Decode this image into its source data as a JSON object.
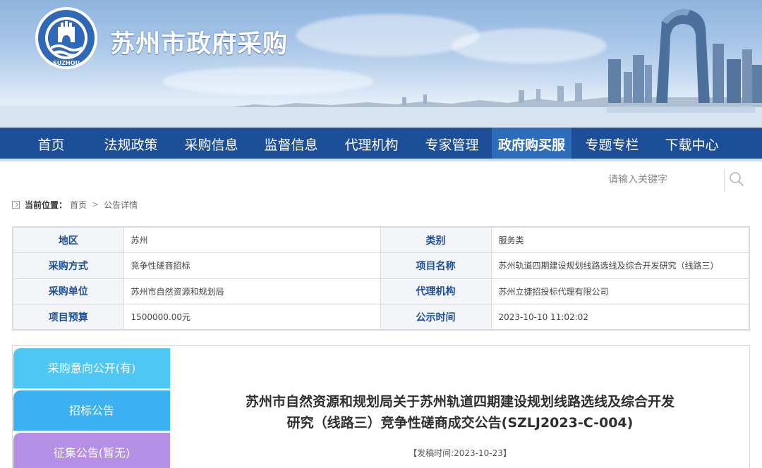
{
  "header": {
    "site_title": "苏州市政府采购",
    "logo_text": "SUZHOU"
  },
  "nav": {
    "items": [
      {
        "label": "首页"
      },
      {
        "label": "法规政策"
      },
      {
        "label": "采购信息"
      },
      {
        "label": "监督信息"
      },
      {
        "label": "代理机构"
      },
      {
        "label": "专家管理"
      },
      {
        "label": "政府购买服务"
      },
      {
        "label": "专题专栏"
      },
      {
        "label": "下载中心"
      }
    ],
    "active_index": 6
  },
  "search": {
    "placeholder": "请输入关键字",
    "icon": "search-icon"
  },
  "breadcrumb": {
    "label": "当前位置：",
    "home": "首页",
    "separator": ">",
    "current": "公告详情"
  },
  "info_table": {
    "rows": [
      {
        "k1": "地区",
        "v1": "苏州",
        "k2": "类别",
        "v2": "服务类"
      },
      {
        "k1": "采购方式",
        "v1": "竞争性磋商招标",
        "k2": "项目名称",
        "v2": "苏州轨道四期建设规划线路选线及综合开发研究（线路三）"
      },
      {
        "k1": "采购单位",
        "v1": "苏州市自然资源和规划局",
        "k2": "代理机构",
        "v2": "苏州立捷招投标代理有限公司"
      },
      {
        "k1": "项目预算",
        "v1": "1500000.00元",
        "k2": "公示时间",
        "v2": "2023-10-10 11:02:02"
      }
    ]
  },
  "side_tabs": [
    {
      "label": "采购意向公开(有)",
      "color": "#4fc7f4"
    },
    {
      "label": "招标公告",
      "color": "#3db0f2"
    },
    {
      "label": "征集公告(暂无)",
      "color": "#b58ee6"
    }
  ],
  "notice": {
    "title_line1": "苏州市自然资源和规划局关于苏州轨道四期建设规划线路选线及综合开发",
    "title_line2": "研究（线路三）竞争性磋商成交公告(SZLJ2023-C-004)",
    "date": "【发稿时间:2023-10-23】"
  },
  "colors": {
    "nav_bg": "#1d4e98",
    "nav_active": "#2d6bbb",
    "key_text": "#1d4e98"
  }
}
